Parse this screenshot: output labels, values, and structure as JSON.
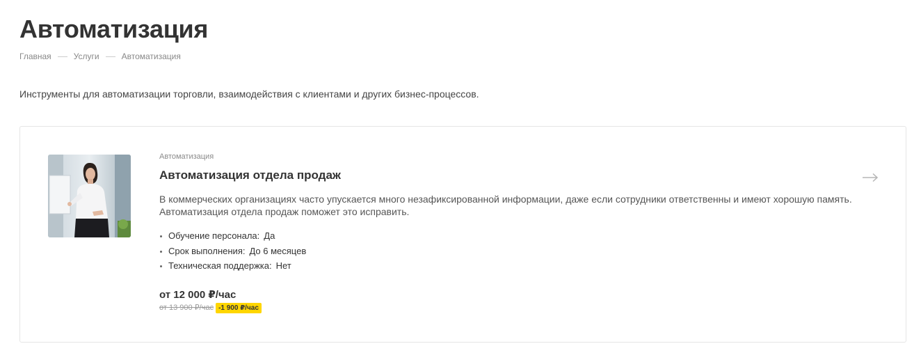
{
  "page": {
    "title": "Автоматизация",
    "intro": "Инструменты для автоматизации торговли, взаимодействия с клиентами и других бизнес-процессов."
  },
  "breadcrumb": [
    {
      "label": "Главная"
    },
    {
      "label": "Услуги"
    },
    {
      "label": "Автоматизация"
    }
  ],
  "card": {
    "image_icon": "businesswoman-photo",
    "category": "Автоматизация",
    "title": "Автоматизация отдела продаж",
    "description": "В коммерческих организациях часто упускается много незафиксированной информации, даже если сотрудники ответственны и имеют хорошую память. Автоматизация отдела продаж поможет это исправить.",
    "properties": [
      {
        "name": "Обучение персонала:",
        "value": "Да"
      },
      {
        "name": "Срок выполнения:",
        "value": "До 6 месяцев"
      },
      {
        "name": "Техническая поддержка:",
        "value": "Нет"
      }
    ],
    "price": "от 12 000 ₽/час",
    "old_price": "от 13 900 ₽/час",
    "discount": "-1 900 ₽/час",
    "arrow_icon": "arrow-right-icon"
  },
  "colors": {
    "text": "#333333",
    "muted": "#888888",
    "border": "#e5e5e5",
    "discount_bg": "#ffd600"
  }
}
